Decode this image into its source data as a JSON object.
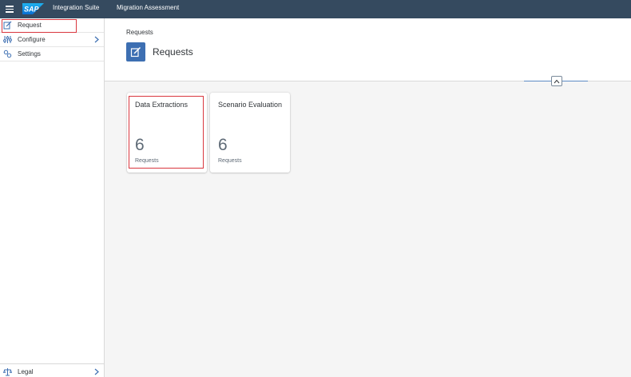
{
  "shell": {
    "logo_text": "SAP",
    "product": "Integration Suite",
    "app_title": "Migration Assessment"
  },
  "sidenav": {
    "items": [
      {
        "label": "Request",
        "icon": "request-edit-icon",
        "selected": true
      },
      {
        "label": "Configure",
        "icon": "configure-sliders-icon",
        "has_children": true
      },
      {
        "label": "Settings",
        "icon": "settings-gears-icon"
      }
    ],
    "footer": {
      "label": "Legal",
      "icon": "legal-scales-icon",
      "has_children": true
    }
  },
  "page": {
    "breadcrumb": "Requests",
    "title": "Requests",
    "icon": "request-edit-icon"
  },
  "tiles": [
    {
      "title": "Data Extractions",
      "value": "6",
      "unit": "Requests",
      "highlighted": true
    },
    {
      "title": "Scenario Evaluation",
      "value": "6",
      "unit": "Requests"
    }
  ],
  "colors": {
    "shell": "#354a5f",
    "accent": "#3d6fb2",
    "highlight": "#d9363e"
  }
}
